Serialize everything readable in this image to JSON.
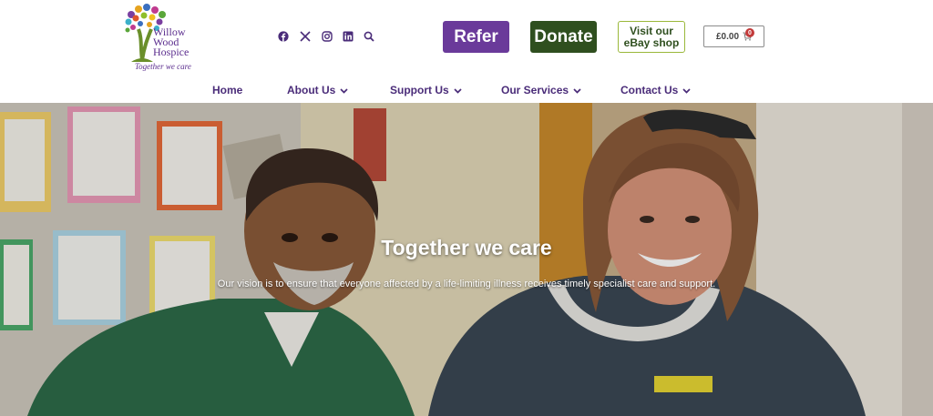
{
  "logo": {
    "name_line1": "Willow",
    "name_line2": "Wood",
    "name_line3": "Hospice",
    "tagline": "Together we care"
  },
  "social": [
    {
      "icon": "facebook-icon"
    },
    {
      "icon": "x-icon"
    },
    {
      "icon": "instagram-icon"
    },
    {
      "icon": "linkedin-icon"
    },
    {
      "icon": "search-icon"
    }
  ],
  "buttons": {
    "refer": "Refer",
    "donate": "Donate",
    "ebay_line1": "Visit our",
    "ebay_line2": "eBay shop",
    "cart_total": "£0.00",
    "cart_count": "0"
  },
  "nav": {
    "home": "Home",
    "about": "About Us",
    "support": "Support Us",
    "services": "Our Services",
    "contact": "Contact Us"
  },
  "hero": {
    "title": "Together we care",
    "subtitle": "Our vision is to ensure that everyone affected by a life-limiting illness receives timely specialist care and support."
  },
  "colors": {
    "brand_purple": "#6a3a9a",
    "nav_purple": "#4a2c79",
    "brand_green": "#2f4f1f",
    "ebay_border": "#9ab83a"
  }
}
